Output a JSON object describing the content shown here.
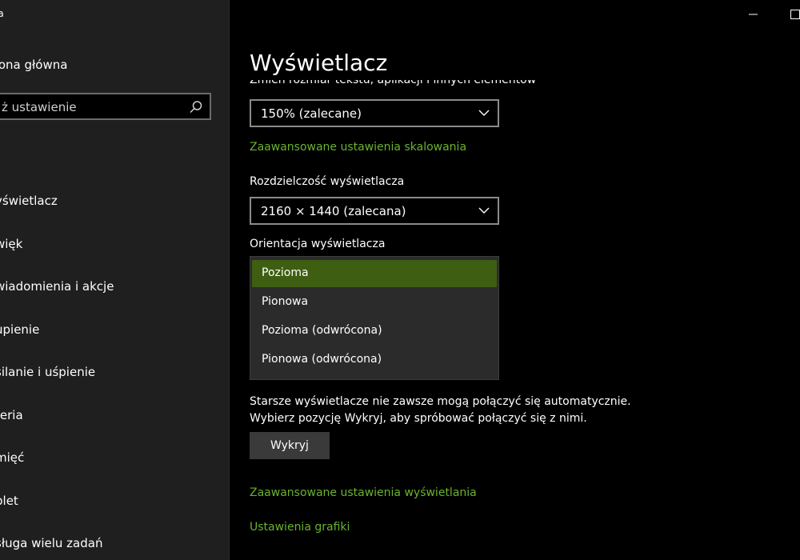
{
  "window": {
    "app_title": "ia"
  },
  "sidebar": {
    "home_label": "rona główna",
    "search_placeholder": "ż ustawienie",
    "items": [
      {
        "label": "yświetlacz"
      },
      {
        "label": "więk"
      },
      {
        "label": "wiadomienia i akcje"
      },
      {
        "label": "upienie"
      },
      {
        "label": "silanie i uśpienie"
      },
      {
        "label": "teria"
      },
      {
        "label": "mięć"
      },
      {
        "label": "blet"
      },
      {
        "label": "sługa wielu zadań"
      }
    ]
  },
  "main": {
    "title": "Wyświetlacz",
    "scale_label_clipped": "Zmień rozmiar tekstu, aplikacji i innych elementów",
    "scale_value": "150% (zalecane)",
    "advanced_scaling_link": "Zaawansowane ustawienia skalowania",
    "resolution_label": "Rozdzielczość wyświetlacza",
    "resolution_value": "2160 × 1440 (zalecana)",
    "orientation_label": "Orientacja wyświetlacza",
    "orientation_options": [
      {
        "label": "Pozioma",
        "selected": true
      },
      {
        "label": "Pionowa",
        "selected": false
      },
      {
        "label": "Pozioma (odwrócona)",
        "selected": false
      },
      {
        "label": "Pionowa (odwrócona)",
        "selected": false
      }
    ],
    "info_line1": "Starsze wyświetlacze nie zawsze mogą połączyć się automatycznie.",
    "info_line2": "Wybierz pozycję Wykryj, aby spróbować połączyć się z nimi.",
    "detect_button": "Wykryj",
    "advanced_display_link": "Zaawansowane ustawienia wyświetlania",
    "graphics_link": "Ustawienia grafiki"
  },
  "colors": {
    "accent_link": "#6ab22f",
    "selected_option": "#3e5f11",
    "background": "#000000",
    "sidebar": "#1f1f1f"
  },
  "icons": {
    "search": "search-icon",
    "chevron": "chevron-down-icon",
    "minimize": "minimize-icon",
    "maximize": "maximize-icon"
  }
}
